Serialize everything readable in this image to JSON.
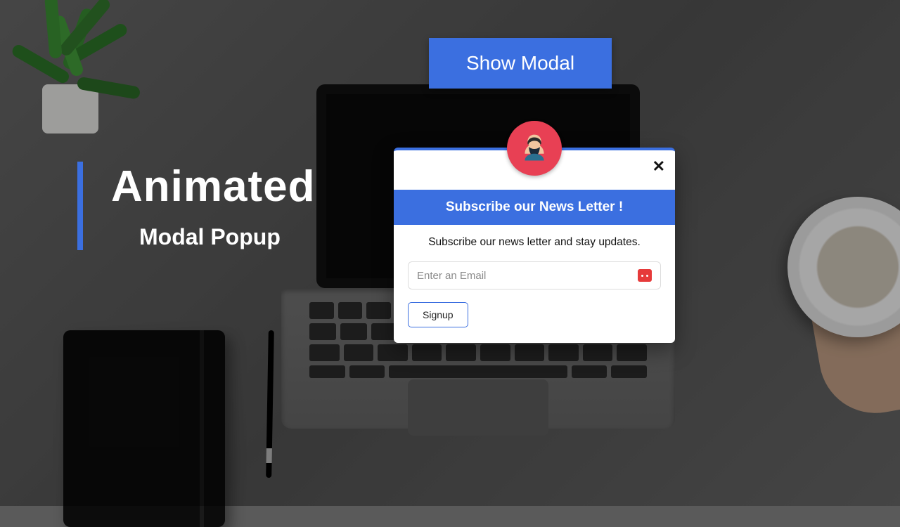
{
  "title": {
    "line1": "Animated",
    "line2": "Modal Popup"
  },
  "trigger": {
    "show_modal_label": "Show Modal"
  },
  "modal": {
    "close_glyph": "✕",
    "banner_title": "Subscribe our News Letter !",
    "description": "Subscribe our news letter and stay updates.",
    "email_placeholder": "Enter an Email",
    "signup_label": "Signup"
  },
  "colors": {
    "accent": "#3b6fe0",
    "avatar_bg": "#e84054"
  }
}
